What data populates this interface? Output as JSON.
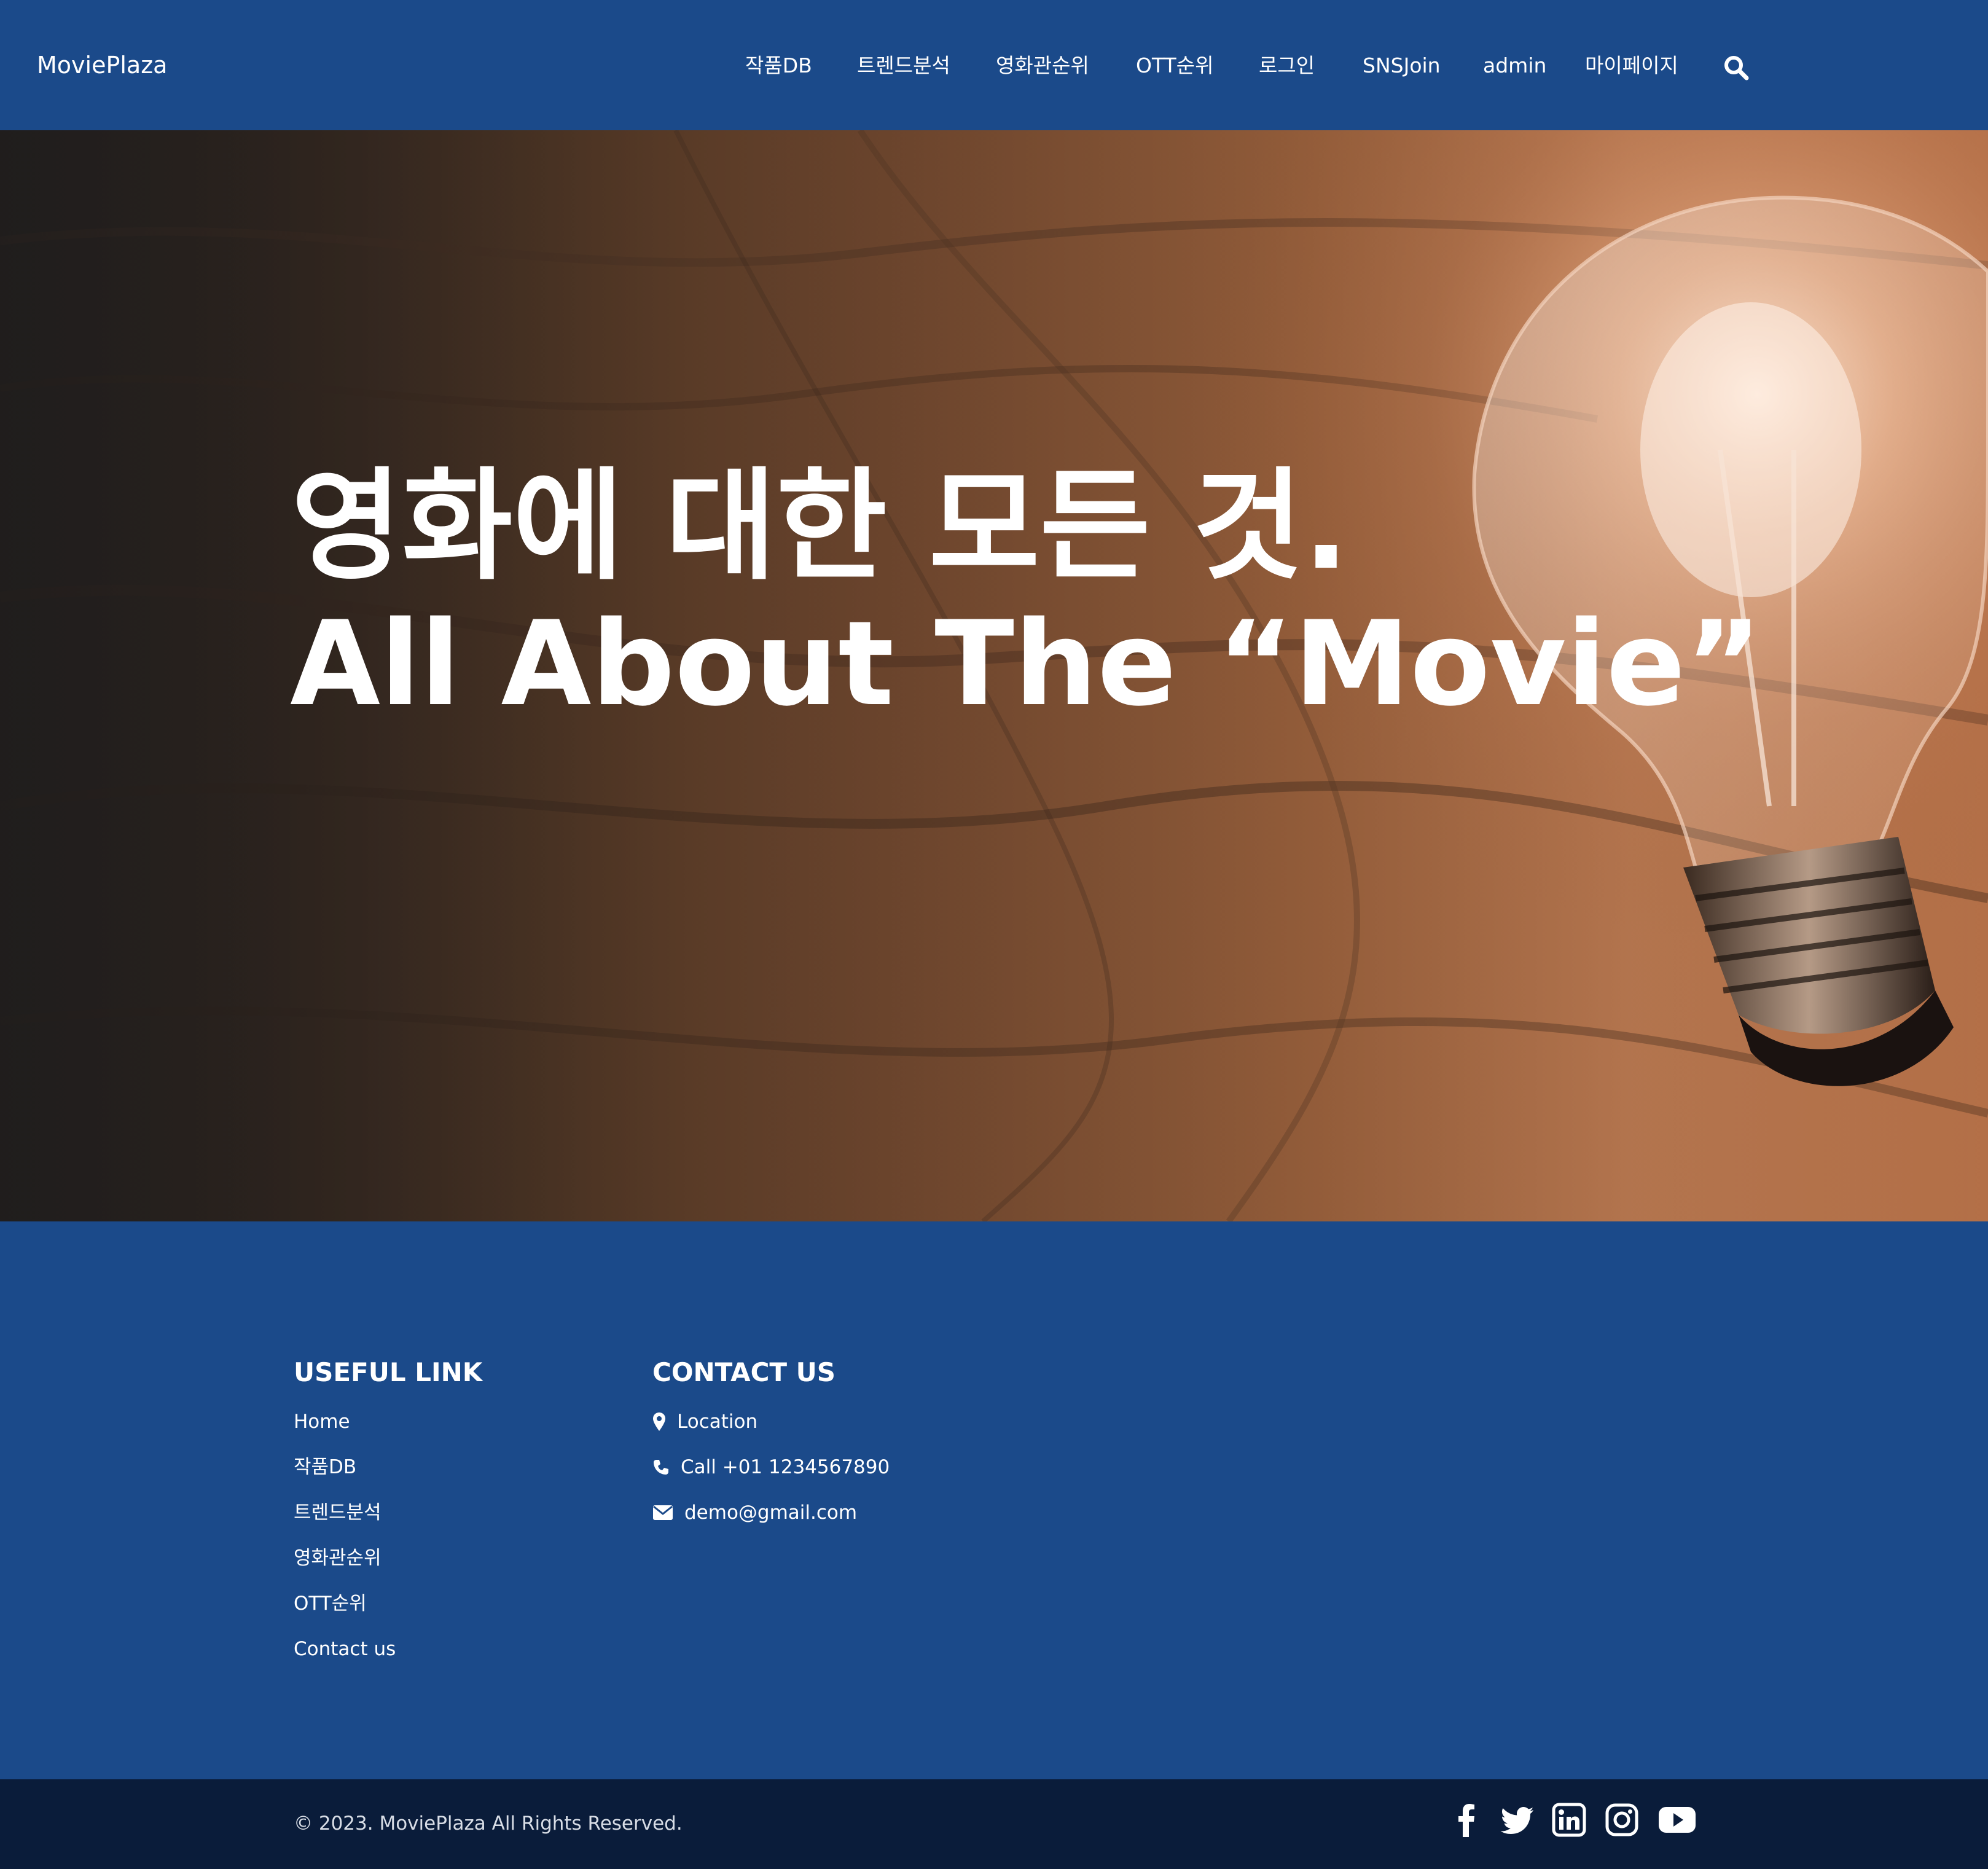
{
  "brand": "MoviePlaza",
  "nav": {
    "items": [
      "작품DB",
      "트렌드분석",
      "영화관순위",
      "OTT순위",
      "로그인",
      "SNSJoin",
      "admin",
      "마이페이지"
    ],
    "search_icon": "search-icon"
  },
  "hero": {
    "line1": "영화에 대한 모든 것.",
    "line2": "All About The “Movie”"
  },
  "footer": {
    "useful_link_title": "USEFUL LINK",
    "useful_links": [
      "Home",
      "작품DB",
      "트렌드분석",
      "영화관순위",
      "OTT순위",
      "Contact us"
    ],
    "contact_title": "CONTACT US",
    "contact": {
      "location": "Location",
      "call": "Call +01 1234567890",
      "email": "demo@gmail.com"
    },
    "copyright": "© 2023. MoviePlaza All Rights Reserved.",
    "social_icons": [
      "facebook-icon",
      "twitter-icon",
      "linkedin-icon",
      "instagram-icon",
      "youtube-icon"
    ]
  },
  "colors": {
    "primary": "#1b4a8a",
    "footer_bottom": "#0a1c3a",
    "text": "#ffffff"
  }
}
